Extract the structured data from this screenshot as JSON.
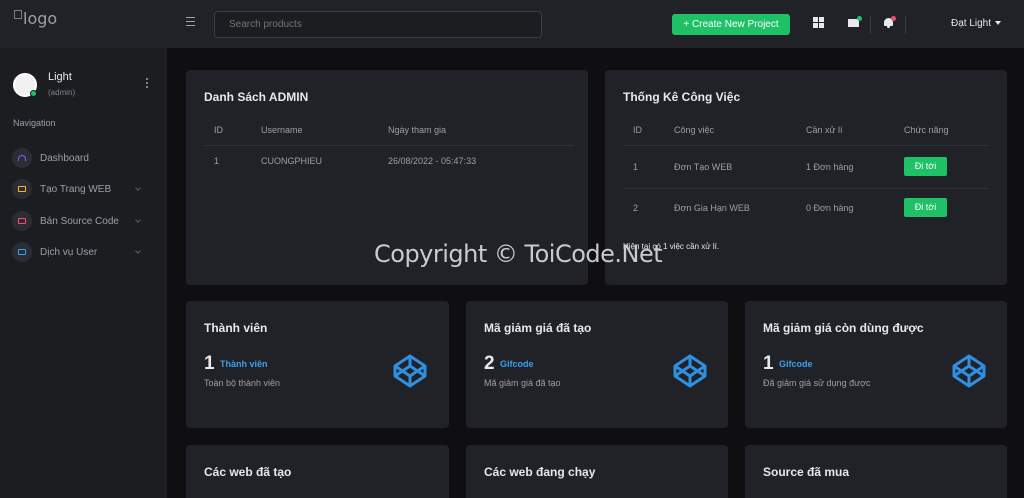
{
  "header": {
    "logo_alt": "logo",
    "search_placeholder": "Search products",
    "create_button": "+ Create New Project",
    "user_menu_label": "Đạt Light"
  },
  "sidebar": {
    "user_name": "Light",
    "user_role": "(admin)",
    "nav_heading": "Navigation",
    "items": [
      {
        "label": "Dashboard",
        "icon": "dashboard-icon",
        "color": "#7b61ff"
      },
      {
        "label": "Tạo Trang WEB",
        "icon": "monitor-icon",
        "color": "#f7b924"
      },
      {
        "label": "Bán Source Code",
        "icon": "monitor-icon",
        "color": "#f0506e"
      },
      {
        "label": "Dịch vụ User",
        "icon": "monitor-icon",
        "color": "#3aa0f0"
      }
    ]
  },
  "admin_card": {
    "title": "Danh Sách ADMIN",
    "columns": [
      "ID",
      "Username",
      "Ngày tham gia"
    ],
    "rows": [
      {
        "id": "1",
        "username": "CUONGPHIEU",
        "joined": "26/08/2022 - 05:47:33"
      }
    ]
  },
  "tasks_card": {
    "title": "Thống Kê Công Việc",
    "columns": [
      "ID",
      "Công việc",
      "Cần xử lí",
      "Chức năng"
    ],
    "rows": [
      {
        "id": "1",
        "task": "Đơn Tạo WEB",
        "pending": "1 Đơn hàng",
        "action": "Đi tới"
      },
      {
        "id": "2",
        "task": "Đơn Gia Hạn WEB",
        "pending": "0 Đơn hàng",
        "action": "Đi tới"
      }
    ],
    "note": "Hiện tại có 1 việc cần xử lí."
  },
  "stats": [
    {
      "title": "Thành viên",
      "number": "1",
      "tag": "Thành viên",
      "desc": "Toàn bộ thành viên"
    },
    {
      "title": "Mã giảm giá đã tạo",
      "number": "2",
      "tag": "Gifcode",
      "desc": "Mã giảm giá đã tạo"
    },
    {
      "title": "Mã giảm giá còn dùng được",
      "number": "1",
      "tag": "Gifcode",
      "desc": "Đã giảm giá sử dụng được"
    },
    {
      "title": "Các web đã tạo"
    },
    {
      "title": "Các web đang chạy"
    },
    {
      "title": "Source đã mua"
    }
  ],
  "watermark": "Copyright © ToiCode.Net",
  "colors": {
    "accent_green": "#1fc167",
    "link_blue": "#3aa0f0",
    "cube_blue": "#2f8fe0"
  }
}
